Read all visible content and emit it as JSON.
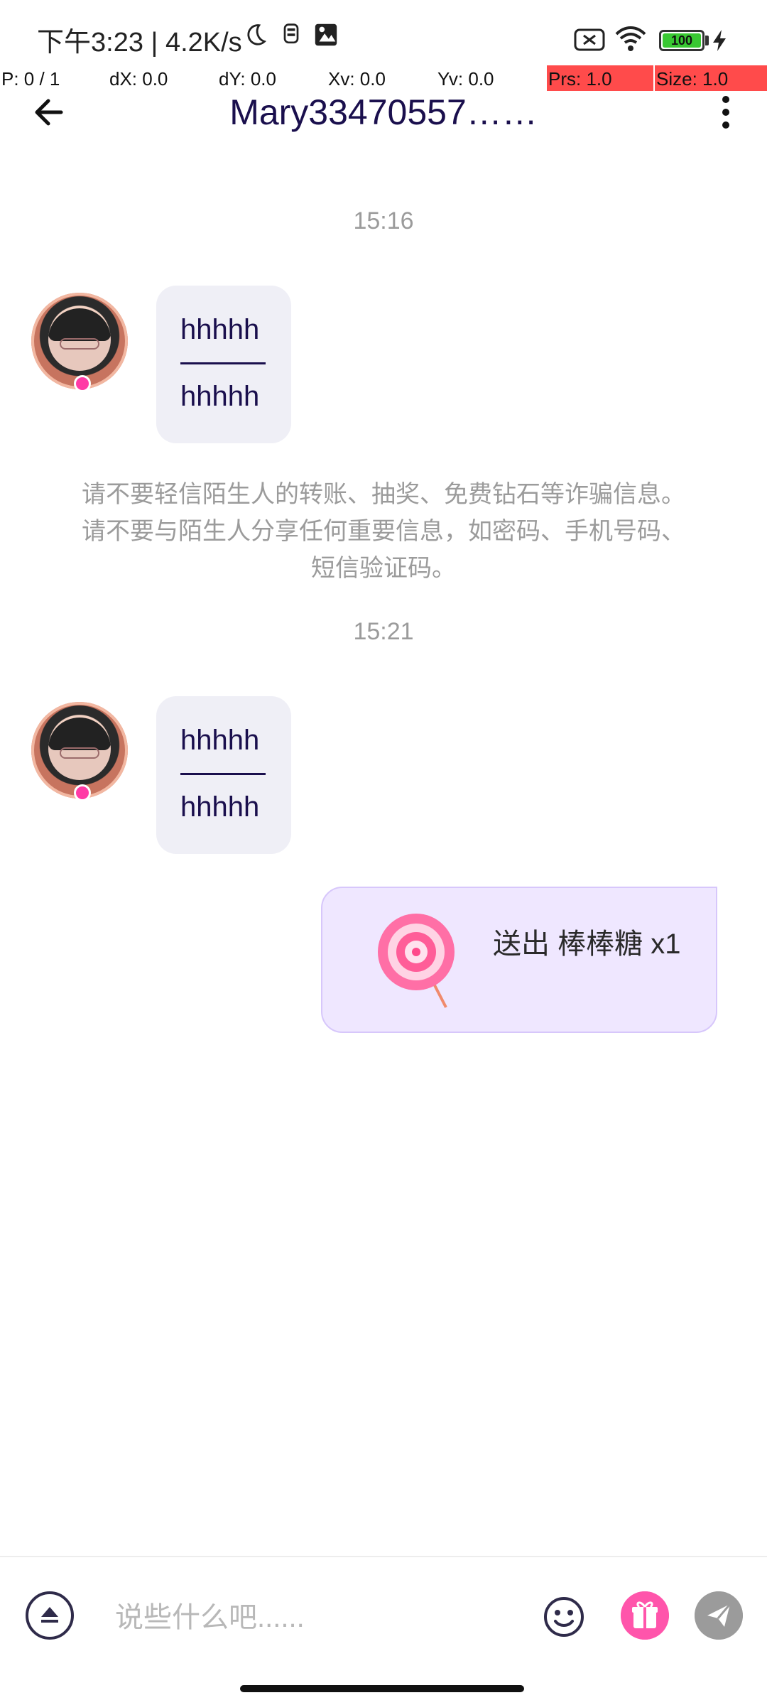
{
  "status_bar": {
    "time_speed": "下午3:23 | 4.2K/s",
    "battery_level": "100",
    "icons": [
      "moon-icon",
      "usb-debug-icon",
      "image-icon",
      "sim-disabled-icon",
      "wifi-icon",
      "battery-icon",
      "charging-bolt-icon"
    ]
  },
  "debug": {
    "p": "P: 0 / 1",
    "dx": "dX: 0.0",
    "dy": "dY: 0.0",
    "xv": "Xv: 0.0",
    "yv": "Yv: 0.0",
    "prs": "Prs: 1.0",
    "size": "Size: 1.0"
  },
  "header": {
    "title": "Mary33470557……",
    "icons": [
      "arrow-left-icon",
      "more-vertical-icon"
    ]
  },
  "chat": {
    "time1": "15:16",
    "msg1_line1": "hhhhh",
    "msg1_line2": "hhhhh",
    "warning": "请不要轻信陌生人的转账、抽奖、免费钻石等诈骗信息。 请不要与陌生人分享任何重要信息，如密码、手机号码、短信验证码。",
    "time2": "15:21",
    "msg2_line1": "hhhhh",
    "msg2_line2": "hhhhh",
    "gift_text": "送出 棒棒糖 x1"
  },
  "input": {
    "placeholder": "说些什么吧......",
    "icons": [
      "expand-up-icon",
      "emoji-icon",
      "gift-icon",
      "send-icon"
    ]
  },
  "colors": {
    "accent": "#1a0f4d",
    "bubble_bg": "#efeff6",
    "gift_bubble_bg": "#efe7ff",
    "gift_btn": "#ff4fa7"
  }
}
